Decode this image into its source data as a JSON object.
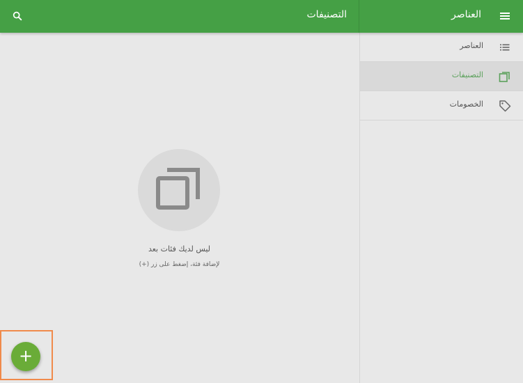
{
  "colors": {
    "primary": "#45a045",
    "accent": "#6aac38",
    "active_text": "#5aa05a",
    "highlight": "#f08a4b"
  },
  "topbar": {
    "app_title": "العناصر",
    "page_title": "التصنيفات",
    "menu_icon": "hamburger-menu-icon",
    "search_icon": "search-icon"
  },
  "sidebar": {
    "items": [
      {
        "label": "العناصر",
        "icon": "list-icon",
        "active": false
      },
      {
        "label": "التصنيفات",
        "icon": "categories-icon",
        "active": true
      },
      {
        "label": "الخصومات",
        "icon": "tag-icon",
        "active": false
      }
    ]
  },
  "empty_state": {
    "icon": "categories-icon",
    "title": "ليس لديك فئات بعد",
    "subtitle": "لإضافة فئة، إضغط على زر (+)"
  },
  "fab": {
    "label": "+",
    "icon": "add-icon"
  }
}
